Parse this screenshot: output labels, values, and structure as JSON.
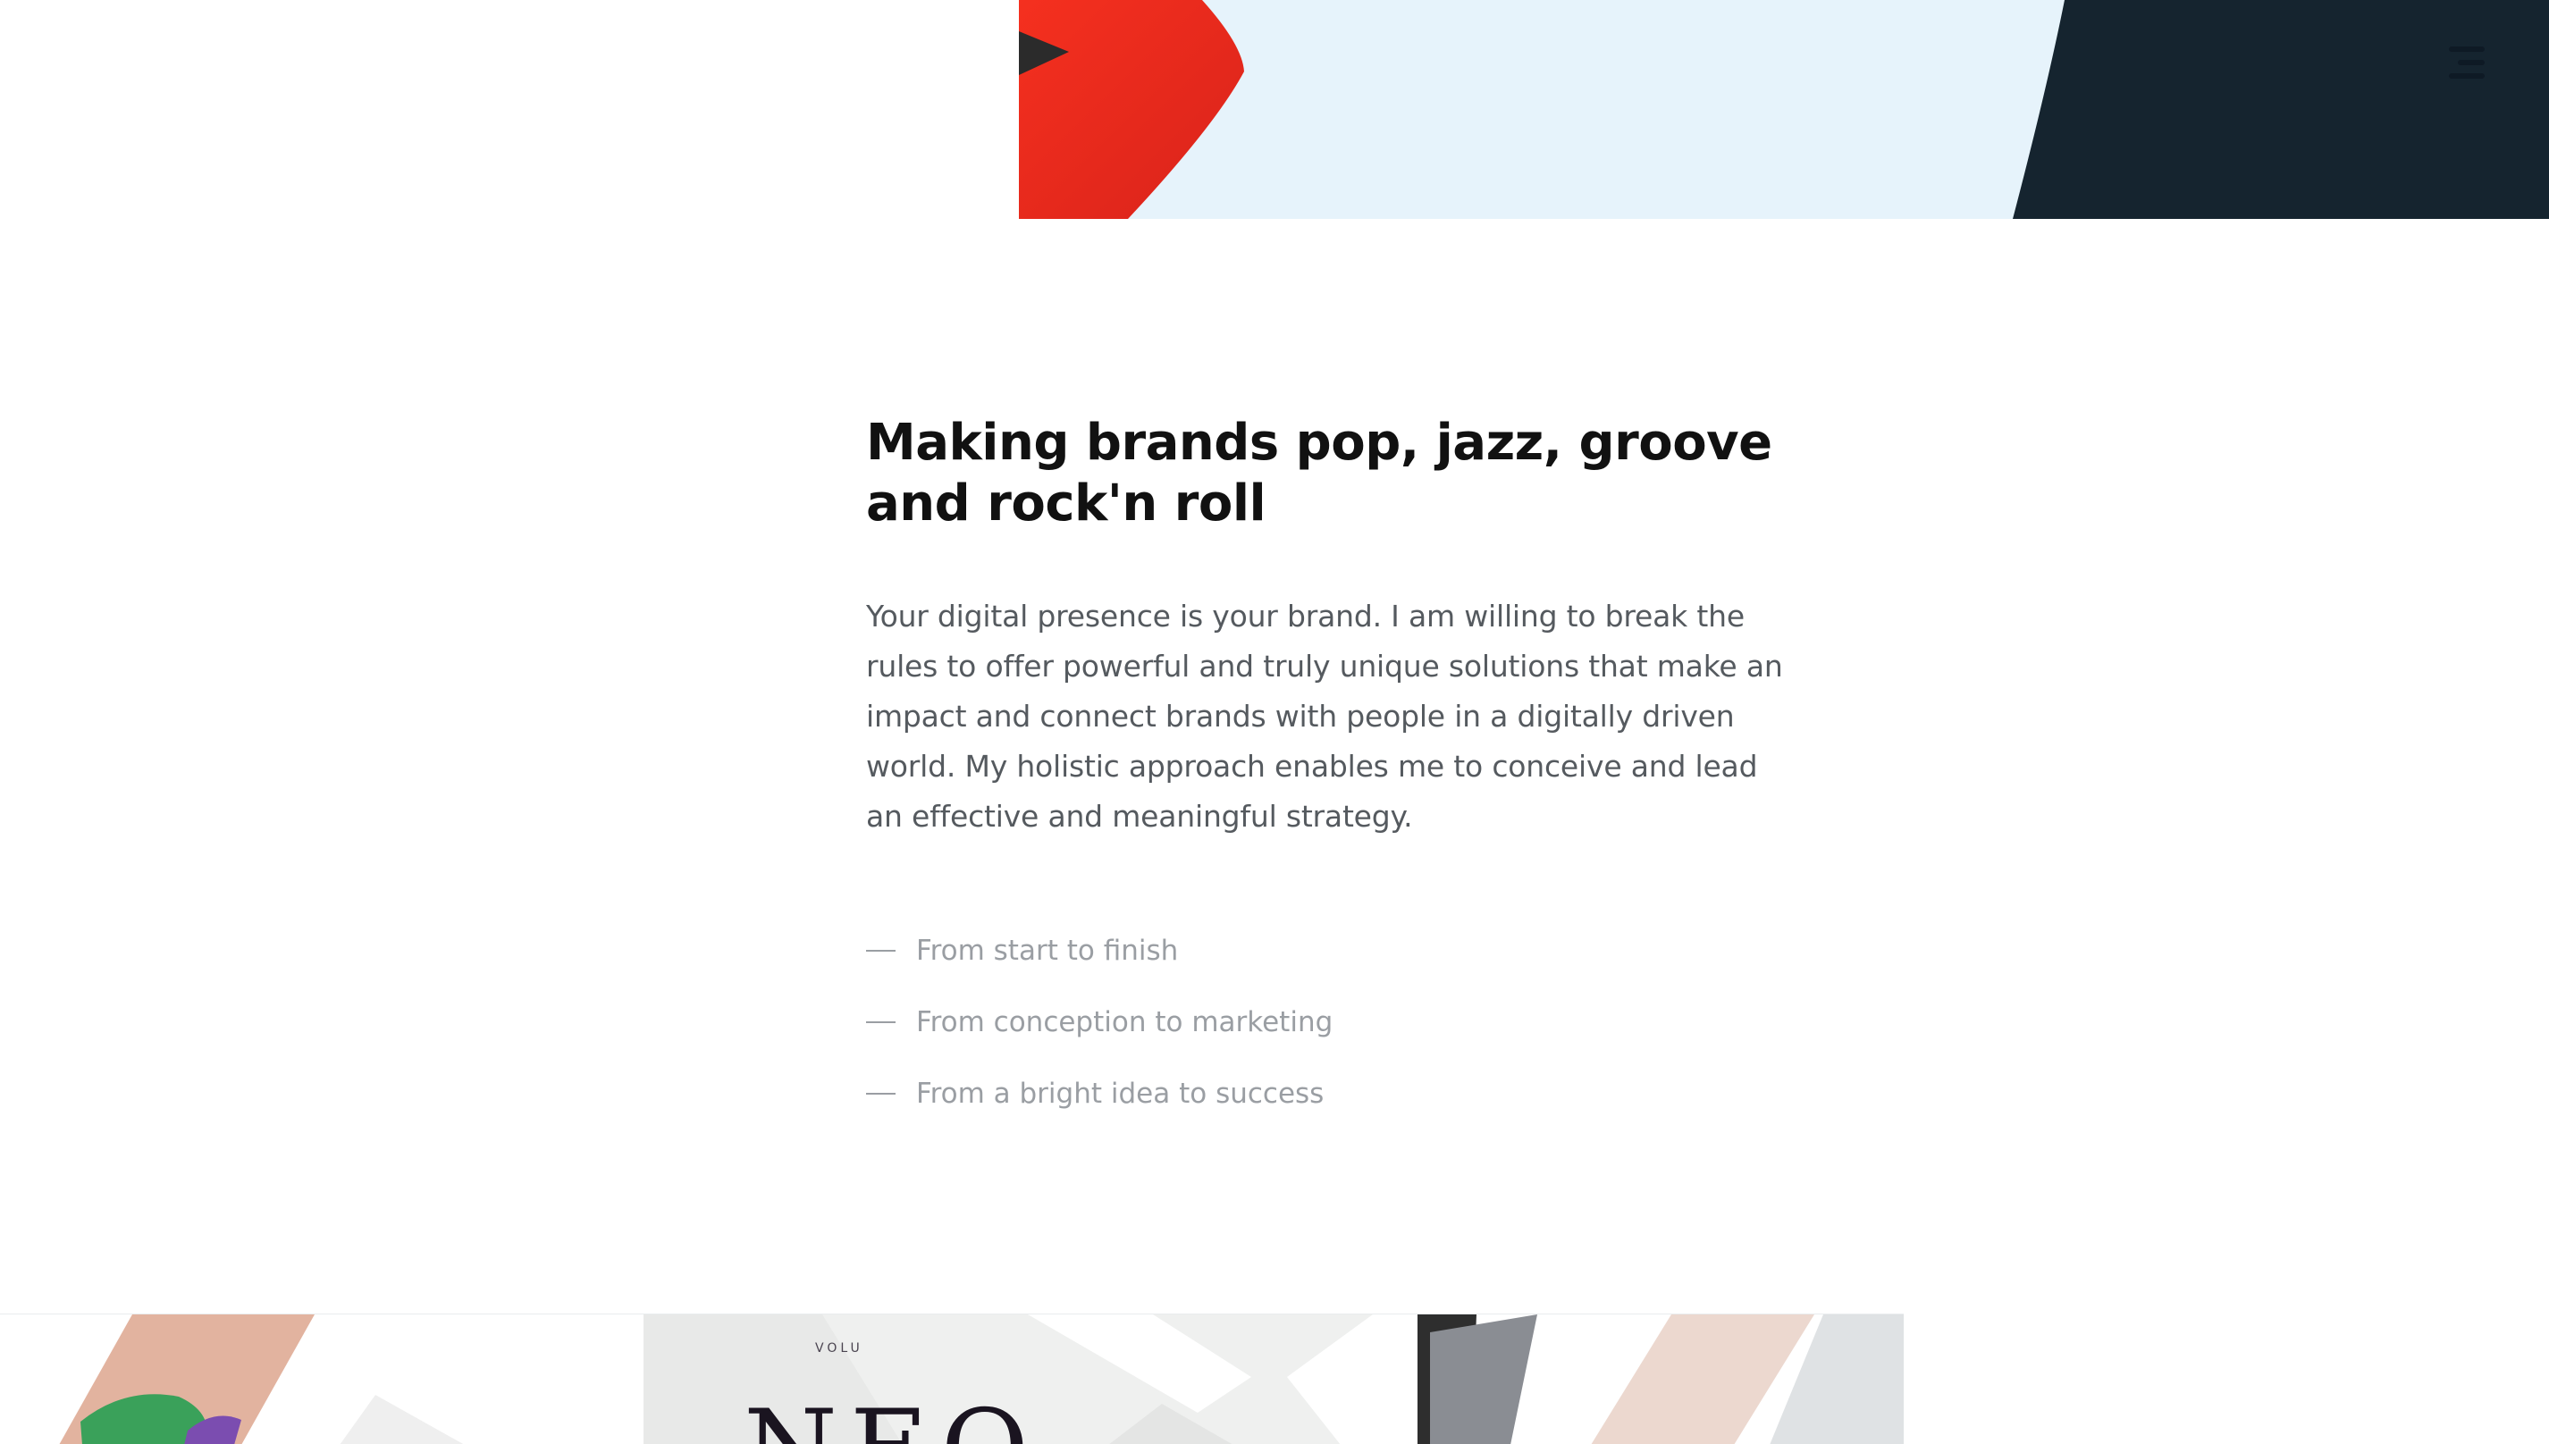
{
  "header": {
    "menu_icon": "hamburger-menu-icon",
    "colors": {
      "red": "#e8261e",
      "light_blue": "#e6f3fb",
      "navy": "#15242f"
    }
  },
  "intro": {
    "title": "Making brands pop, jazz, groove and rock'n roll",
    "description": "Your digital presence is your brand. I am willing to break the rules to offer powerful and truly unique solutions that make an impact and connect brands with people in a digitally driven world. My holistic approach enables me to conceive and lead an effective and meaningful strategy.",
    "features": [
      "From start to finish",
      "From conception to marketing",
      "From a bright idea to success"
    ]
  },
  "portfolio": {
    "cover_small_text": "VOLU",
    "cover_big_text": "NEO"
  }
}
